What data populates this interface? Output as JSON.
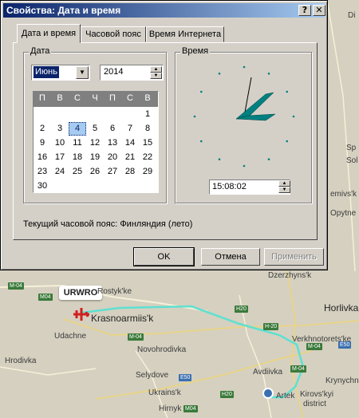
{
  "dialog": {
    "title": "Свойства: Дата и время",
    "help_btn": "?",
    "close_btn": "✕"
  },
  "tabs": [
    {
      "label": "Дата и время",
      "active": true
    },
    {
      "label": "Часовой пояс",
      "active": false
    },
    {
      "label": "Время Интернета",
      "active": false
    }
  ],
  "date_group": {
    "label": "Дата",
    "month": "Июнь",
    "year": "2014"
  },
  "calendar": {
    "weekdays": [
      "П",
      "В",
      "С",
      "Ч",
      "П",
      "С",
      "В"
    ],
    "days": [
      "1",
      "2",
      "3",
      "4",
      "5",
      "6",
      "7",
      "8",
      "9",
      "10",
      "11",
      "12",
      "13",
      "14",
      "15",
      "16",
      "17",
      "18",
      "19",
      "20",
      "21",
      "22",
      "23",
      "24",
      "25",
      "26",
      "27",
      "28",
      "29",
      "30"
    ],
    "selected_day": "4"
  },
  "time_group": {
    "label": "Время",
    "time": "15:08:02"
  },
  "timezone_text": "Текущий часовой пояс: Финляндия (лето)",
  "buttons": {
    "ok": "OK",
    "cancel": "Отмена",
    "apply": "Применить"
  },
  "map": {
    "marker_label": "URWRO",
    "labels": {
      "roslyk": "Rostyk'ke",
      "dzerzhynsk": "Dzerzhyns'k",
      "horlivka": "Horlivka",
      "krasnoarmiisk": "Krasnoarmiis'k",
      "udachne": "Udachne",
      "verkhnotoretske": "Verkhnotorets'ke",
      "novohrodivka": "Novohrodivka",
      "hrodivka": "Hrodivka",
      "avdiivka": "Avdiivka",
      "selydove": "Selydove",
      "krynychni": "Krynychn",
      "ukrainsk": "Ukrains'k",
      "hirnyk": "Hirnyk",
      "kirovskyi": "Kirovs'kyi",
      "district": "district",
      "artek": "Artek",
      "opytne": "Opytne",
      "semivsk": "emivs'k",
      "sol": "Sol",
      "sp": "Sp",
      "di": "Di"
    },
    "shields": [
      "M-04",
      "M04",
      "H20",
      "H-20",
      "M-04",
      "M-04",
      "E50",
      "E50",
      "M04",
      "H20",
      "M-04"
    ],
    "flight_color": "#5fe0d0"
  },
  "colors": {
    "titlebar_start": "#0a246a",
    "titlebar_end": "#a6caf0",
    "face": "#d4d0c8",
    "clock_tick": "#008080"
  }
}
